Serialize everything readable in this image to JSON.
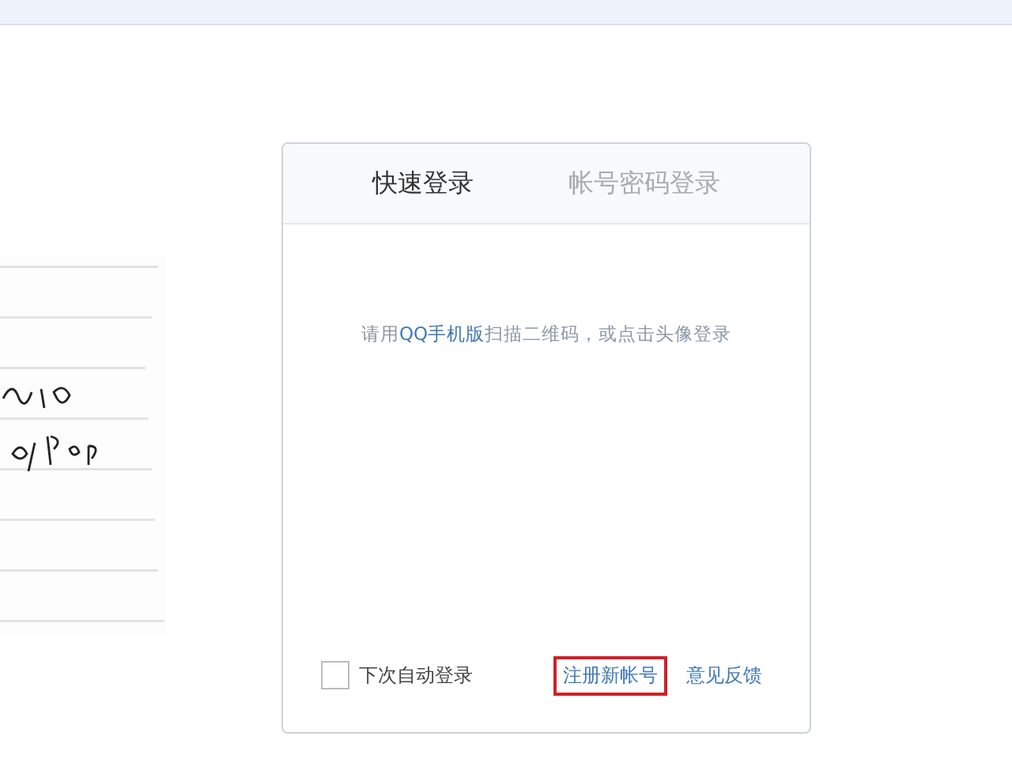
{
  "login_panel": {
    "tabs": [
      {
        "label": "快速登录",
        "selected": true
      },
      {
        "label": "帐号密码登录",
        "selected": false
      }
    ],
    "hint": {
      "before": "请用",
      "link": "QQ手机版",
      "after": "扫描二维码，或点击头像登录"
    },
    "auto_login": {
      "label": "下次自动登录",
      "checked": false
    },
    "links": [
      {
        "label": "注册新帐号",
        "highlighted": true
      },
      {
        "label": "意见反馈",
        "highlighted": false
      }
    ]
  }
}
